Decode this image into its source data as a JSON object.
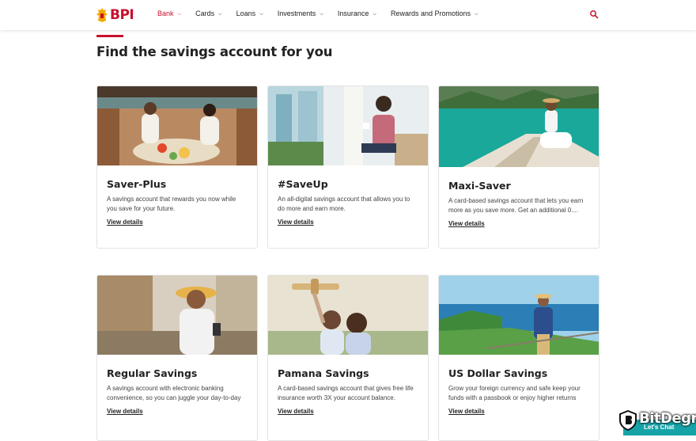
{
  "header": {
    "logo_text": "BPI",
    "nav": [
      {
        "label": "Bank",
        "active": true
      },
      {
        "label": "Cards",
        "active": false
      },
      {
        "label": "Loans",
        "active": false
      },
      {
        "label": "Investments",
        "active": false
      },
      {
        "label": "Insurance",
        "active": false
      },
      {
        "label": "Rewards and Promotions",
        "active": false
      }
    ],
    "search_icon": "search-icon"
  },
  "section": {
    "title": "Find the savings account for you"
  },
  "cards": [
    {
      "title": "Saver-Plus",
      "description": "A savings account that rewards you now while you save for your future.",
      "link": "View details",
      "image": "couple-dining-on-boat"
    },
    {
      "title": "#SaveUp",
      "description": "An all-digital savings account that allows you to do more and earn more.",
      "link": "View details",
      "image": "man-with-coffee-by-window"
    },
    {
      "title": "Maxi-Saver",
      "description": "A card-based savings account that lets you earn more as you save more. Get an additional 0....",
      "link": "View details",
      "image": "woman-on-boat-bow"
    },
    {
      "title": "Regular Savings",
      "description": "A savings account with electronic banking convenience, so you can juggle your day-to-day",
      "link": "View details",
      "image": "woman-with-phone-and-hat"
    },
    {
      "title": "Pamana Savings",
      "description": "A card-based savings account that gives free life insurance worth 3X your account balance.",
      "link": "View details",
      "image": "mother-and-child-with-toy-plane"
    },
    {
      "title": "US Dollar Savings",
      "description": "Grow your foreign currency and safe keep your funds with a passbook or enjoy higher returns",
      "link": "View details",
      "image": "traveler-at-seaside-viewpoint"
    }
  ],
  "badge": {
    "brand": "BitDegree",
    "chat_label": "Let's Chat"
  },
  "colors": {
    "brand_red": "#c8102e",
    "chat_teal": "#15a3a8"
  }
}
